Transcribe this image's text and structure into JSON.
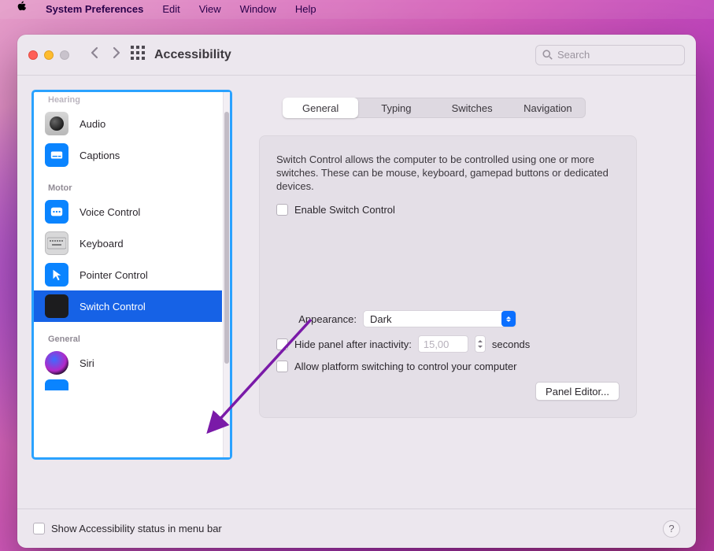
{
  "menubar": {
    "app_name": "System Preferences",
    "items": [
      "Edit",
      "View",
      "Window",
      "Help"
    ]
  },
  "window": {
    "title": "Accessibility",
    "search_placeholder": "Search"
  },
  "sidebar": {
    "hearing_cut_label": "Hearing",
    "motor_label": "Motor",
    "general_label": "General",
    "items": [
      {
        "id": "audio",
        "label": "Audio"
      },
      {
        "id": "captions",
        "label": "Captions"
      },
      {
        "id": "voice",
        "label": "Voice Control"
      },
      {
        "id": "keyboard",
        "label": "Keyboard"
      },
      {
        "id": "pointer",
        "label": "Pointer Control"
      },
      {
        "id": "switch",
        "label": "Switch Control"
      },
      {
        "id": "siri",
        "label": "Siri"
      }
    ]
  },
  "tabs": {
    "general": "General",
    "typing": "Typing",
    "switches": "Switches",
    "navigation": "Navigation"
  },
  "panel": {
    "description": "Switch Control allows the computer to be controlled using one or more switches. These can be mouse, keyboard, gamepad buttons or dedicated devices.",
    "enable_label": "Enable Switch Control",
    "appearance_label": "Appearance:",
    "appearance_value": "Dark",
    "hide_label": "Hide panel after inactivity:",
    "hide_value": "15,00",
    "hide_unit": "seconds",
    "platform_label": "Allow platform switching to control your computer",
    "panel_editor_label": "Panel Editor..."
  },
  "footer": {
    "status_label": "Show Accessibility status in menu bar",
    "help_glyph": "?"
  }
}
